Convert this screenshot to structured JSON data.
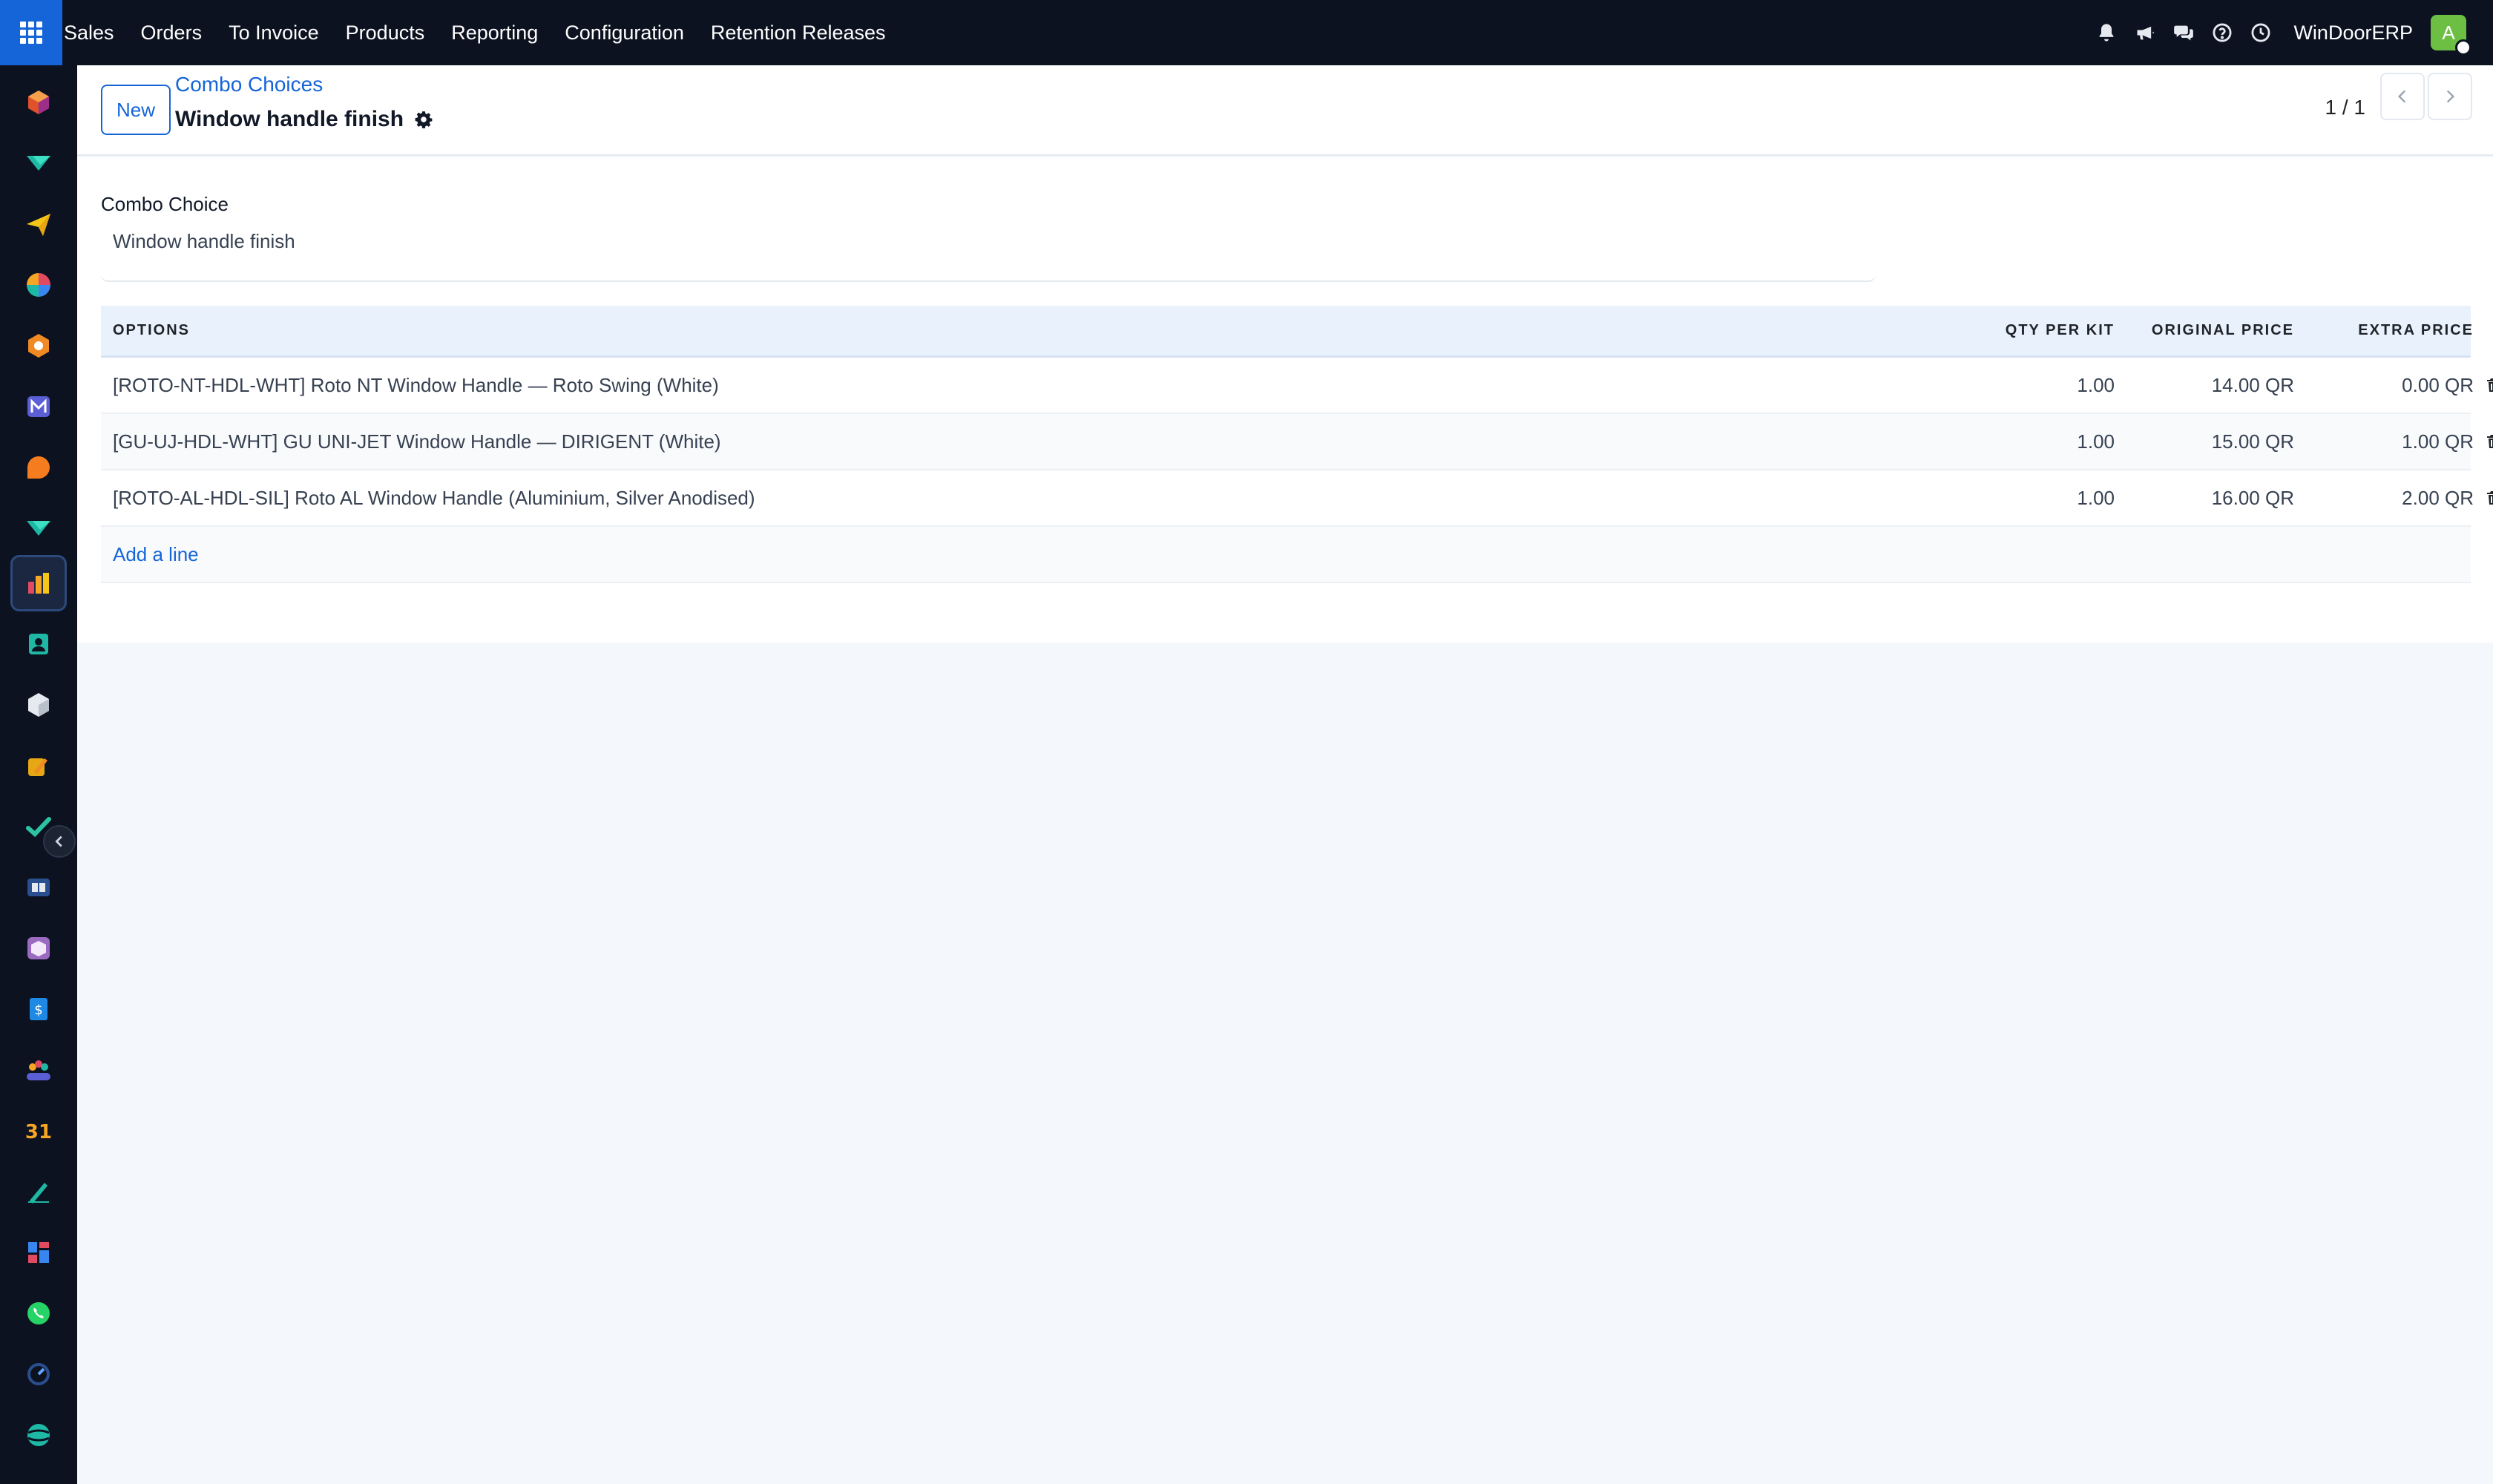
{
  "navbar": {
    "menu": [
      "Sales",
      "Orders",
      "To Invoice",
      "Products",
      "Reporting",
      "Configuration",
      "Retention Releases"
    ],
    "icons": [
      "bell-icon",
      "megaphone-icon",
      "chat-icon",
      "help-icon",
      "clock-icon"
    ],
    "company": "WinDoorERP",
    "avatar_letter": "A",
    "accent": "#1565d8",
    "background": "#0c1220"
  },
  "control": {
    "new_label": "New",
    "breadcrumb": "Combo Choices",
    "title": "Window handle finish",
    "pager": "1 / 1"
  },
  "form": {
    "field_label": "Combo Choice",
    "field_value": "Window handle finish"
  },
  "table": {
    "headers": {
      "options": "OPTIONS",
      "qty": "QTY PER KIT",
      "original": "ORIGINAL PRICE",
      "extra": "EXTRA PRICE"
    },
    "rows": [
      {
        "option": "[ROTO-NT-HDL-WHT] Roto NT Window Handle — Roto Swing (White)",
        "qty": "1.00",
        "original": "14.00 QR",
        "extra": "0.00 QR"
      },
      {
        "option": "[GU-UJ-HDL-WHT] GU UNI-JET Window Handle — DIRIGENT (White)",
        "qty": "1.00",
        "original": "15.00 QR",
        "extra": "1.00 QR"
      },
      {
        "option": "[ROTO-AL-HDL-SIL] Roto AL Window Handle (Aluminium, Silver Anodised)",
        "qty": "1.00",
        "original": "16.00 QR",
        "extra": "2.00 QR"
      }
    ],
    "add_line": "Add a line"
  }
}
